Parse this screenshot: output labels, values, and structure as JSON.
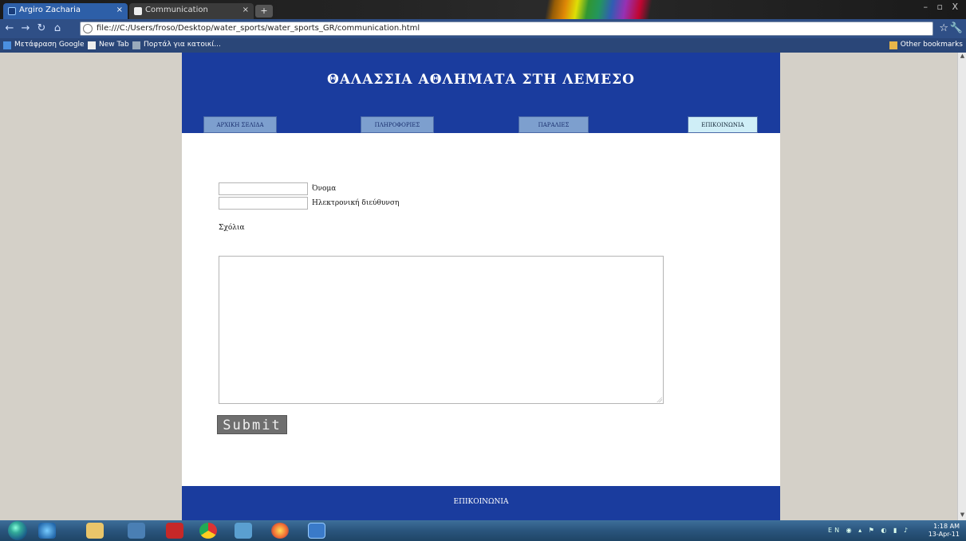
{
  "browser": {
    "tabs": [
      {
        "label": "Argiro Zacharia"
      },
      {
        "label": "Communication"
      }
    ],
    "new_tab_symbol": "+",
    "window_controls": "– ▫ X",
    "url": "file:///C:/Users/froso/Desktop/water_sports/water_sports_GR/communication.html",
    "bookmarks": [
      {
        "label": "Μετάφραση Google"
      },
      {
        "label": "New Tab"
      },
      {
        "label": "Πορτάλ για κατοικί..."
      }
    ],
    "other_bookmarks": "Other bookmarks"
  },
  "page": {
    "title": "ΘΑΛΑΣΣΙΑ ΑΘΛΗΜΑΤΑ ΣΤΗ ΛΕΜΕΣΟ",
    "nav": [
      {
        "label": "ΑΡΧΙΚΗ ΣΕΛΙΔΑ"
      },
      {
        "label": "ΠΛΗΡΟΦΟΡΙΕΣ"
      },
      {
        "label": "ΠΑΡΑΛΙΕΣ"
      },
      {
        "label": "ΕΠΙΚΟΙΝΩΝΙΑ",
        "active": true
      }
    ],
    "form": {
      "name_label": "Όνομα",
      "email_label": "Ηλεκτρονική διεύθυνση",
      "comments_label": "Σχόλια",
      "submit_label": "Submit"
    },
    "footer": "ΕΠΙΚΟΙΝΩΝΙΑ"
  },
  "taskbar": {
    "tray_lang": "EN",
    "time": "1:18 AM",
    "date": "13-Apr-11"
  }
}
